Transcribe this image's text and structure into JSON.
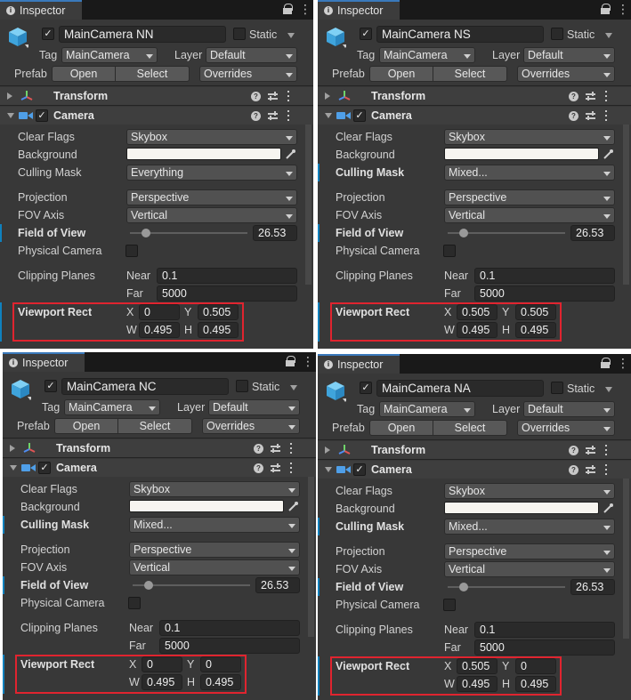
{
  "tab_label": "Inspector",
  "static_label": "Static",
  "tag_label": "Tag",
  "layer_label": "Layer",
  "prefab_label": "Prefab",
  "open_label": "Open",
  "select_label": "Select",
  "overrides_label": "Overrides",
  "tag_value": "MainCamera",
  "layer_value": "Default",
  "transform_label": "Transform",
  "camera_label": "Camera",
  "fields": {
    "clear_flags": "Clear Flags",
    "background": "Background",
    "culling_mask": "Culling Mask",
    "projection": "Projection",
    "fov_axis": "FOV Axis",
    "field_of_view": "Field of View",
    "physical_camera": "Physical Camera",
    "clipping_planes": "Clipping Planes",
    "near": "Near",
    "far": "Far",
    "viewport_rect": "Viewport Rect",
    "x": "X",
    "y": "Y",
    "w": "W",
    "h": "H"
  },
  "values": {
    "clear_flags": "Skybox",
    "projection": "Perspective",
    "fov_axis": "Vertical",
    "fov": "26.53",
    "fov_slider_level": 0.135,
    "near": "0.1",
    "far": "5000"
  },
  "colors": {
    "background_swatch": "#f7f5f0",
    "highlight_box": "#e0242f",
    "modified_bar": "#0f81be",
    "tab_accent": "#3a79bb"
  },
  "panels": [
    {
      "name": "MainCamera NN",
      "culling_mask": "Everything",
      "culling_modified": false,
      "x": "0",
      "y": "0.505",
      "w": "0.495",
      "h": "0.495"
    },
    {
      "name": "MainCamera NS",
      "culling_mask": "Mixed...",
      "culling_modified": true,
      "x": "0.505",
      "y": "0.505",
      "w": "0.495",
      "h": "0.495"
    },
    {
      "name": "MainCamera NC",
      "culling_mask": "Mixed...",
      "culling_modified": true,
      "x": "0",
      "y": "0",
      "w": "0.495",
      "h": "0.495"
    },
    {
      "name": "MainCamera NA",
      "culling_mask": "Mixed...",
      "culling_modified": true,
      "x": "0.505",
      "y": "0",
      "w": "0.495",
      "h": "0.495"
    }
  ],
  "icons": [
    "info-icon",
    "lock-icon",
    "menu-icon",
    "gameobject-cube-icon",
    "transform-axes-icon",
    "camera-icon",
    "help-icon",
    "preset-icon",
    "kebab-menu-icon",
    "eyedropper-icon",
    "foldout-arrow-icon"
  ]
}
